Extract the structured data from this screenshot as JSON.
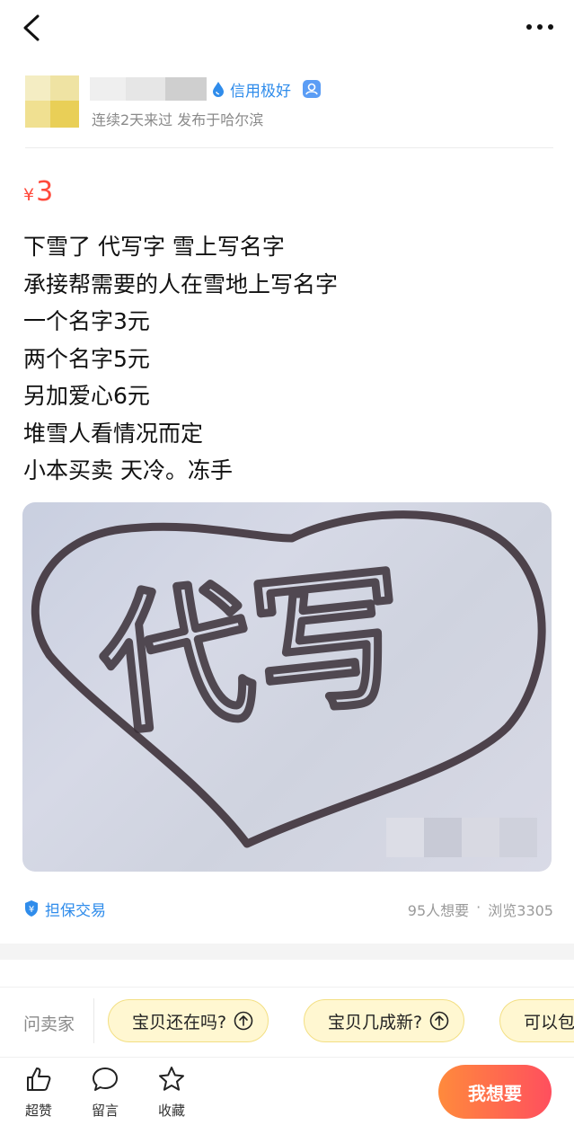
{
  "header": {
    "back_icon": "back-arrow-icon",
    "more_icon": "more-dots-icon"
  },
  "seller": {
    "credit_label": "信用极好",
    "credit_icon": "water-drop-icon",
    "verify_icon": "verified-badge-icon",
    "meta": "连续2天来过 发布于哈尔滨"
  },
  "price": {
    "currency": "¥",
    "value": "3"
  },
  "description": [
    "下雪了 代写字 雪上写名字",
    "承接帮需要的人在雪地上写名字",
    "一个名字3元",
    "两个名字5元",
    "另加爱心6元",
    "堆雪人看情况而定",
    "小本买卖 天冷。冻手"
  ],
  "photo": {
    "text": "代写"
  },
  "stats": {
    "escrow_label": "担保交易",
    "wants": "95人想要",
    "separator": "·",
    "views": "浏览3305"
  },
  "ask": {
    "label": "问卖家",
    "chips": [
      "宝贝还在吗?",
      "宝贝几成新?",
      "可以包"
    ]
  },
  "bottom": {
    "actions": [
      {
        "label": "超赞",
        "icon": "thumb-up-icon"
      },
      {
        "label": "留言",
        "icon": "comment-icon"
      },
      {
        "label": "收藏",
        "icon": "star-icon"
      }
    ],
    "want_button": "我想要"
  },
  "colors": {
    "price": "#ff4a3c",
    "accent_blue": "#2f8ceb",
    "chip_bg": "#fff7d1",
    "button_start": "#ff8a3c",
    "button_end": "#ff4f5e"
  }
}
